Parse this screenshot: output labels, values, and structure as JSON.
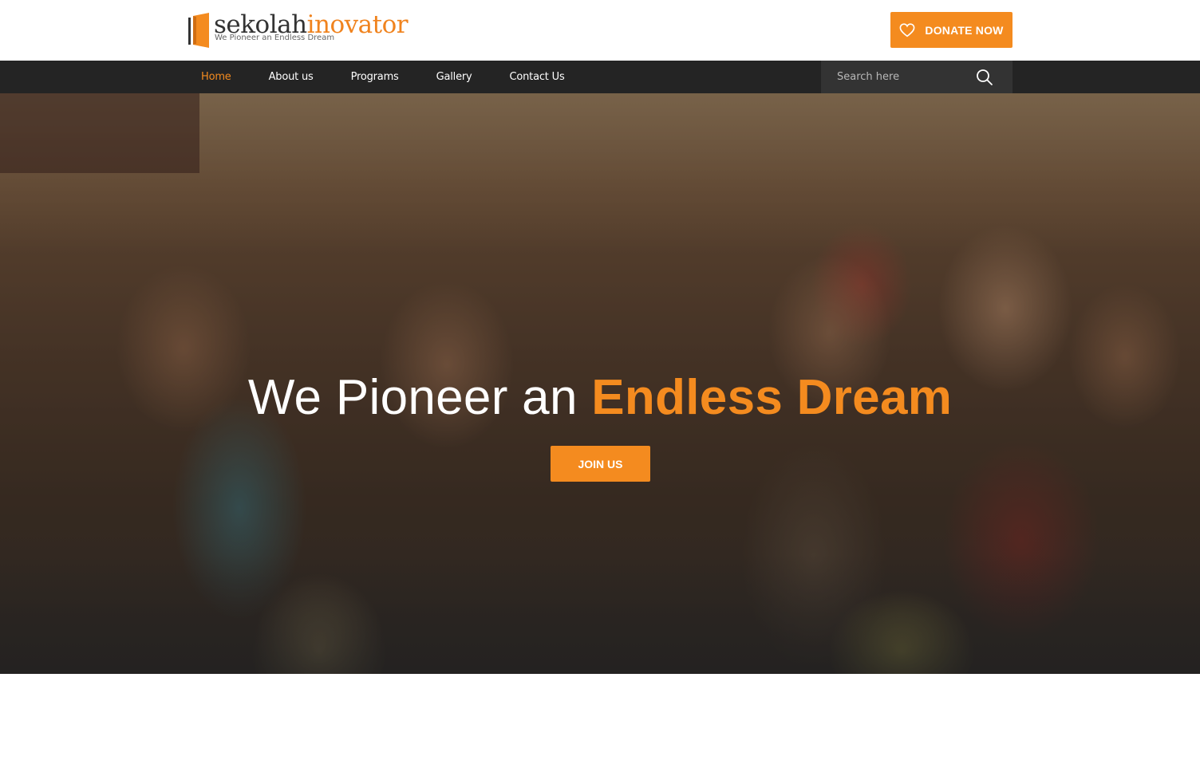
{
  "brand": {
    "name_part1": "sekolah",
    "name_part2": "inovator",
    "tagline": "We Pioneer an Endless Dream",
    "accent_color": "#f48b1f",
    "logo_icon": "open-door-icon"
  },
  "header": {
    "donate_label": "DONATE NOW",
    "donate_icon": "heart-icon"
  },
  "nav": {
    "items": [
      {
        "label": "Home",
        "active": true
      },
      {
        "label": "About us",
        "active": false
      },
      {
        "label": "Programs",
        "active": false
      },
      {
        "label": "Gallery",
        "active": false
      },
      {
        "label": "Contact Us",
        "active": false
      }
    ]
  },
  "search": {
    "placeholder": "Search here",
    "icon": "search-icon"
  },
  "hero": {
    "title_light": "We Pioneer an ",
    "title_accent": "Endless Dream",
    "cta_label": "JOIN US"
  }
}
